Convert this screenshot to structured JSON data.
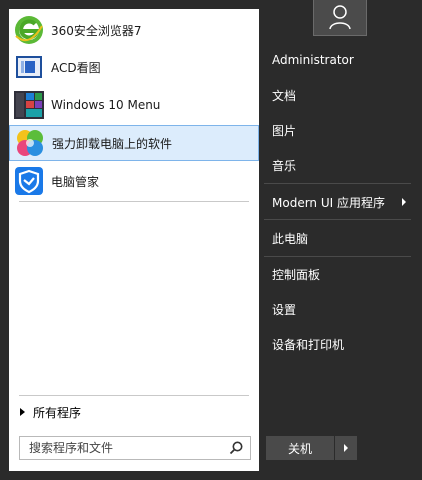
{
  "user": {
    "avatar_icon": "user-icon"
  },
  "programs": [
    {
      "label": "360安全浏览器7",
      "icon": "browser-360-icon"
    },
    {
      "label": "ACD看图",
      "icon": "acdsee-icon"
    },
    {
      "label": "Windows 10 Menu",
      "icon": "windows10-menu-icon"
    },
    {
      "label": "强力卸载电脑上的软件",
      "icon": "uninstaller-icon",
      "selected": true
    },
    {
      "label": "电脑管家",
      "icon": "pc-manager-icon"
    }
  ],
  "all_programs": {
    "label": "所有程序"
  },
  "search": {
    "placeholder": "搜索程序和文件"
  },
  "right_menu": [
    {
      "label": "Administrator"
    },
    {
      "label": "文档"
    },
    {
      "label": "图片"
    },
    {
      "label": "音乐"
    },
    {
      "label": "Modern UI 应用程序"
    },
    {
      "label": "此电脑"
    },
    {
      "label": "控制面板"
    },
    {
      "label": "设置"
    },
    {
      "label": "设备和打印机"
    }
  ],
  "shutdown": {
    "label": "关机"
  },
  "colors": {
    "menu_bg": "#2b2b2b",
    "selected_bg": "#dcecfc",
    "selected_border": "#7eb4ea"
  }
}
